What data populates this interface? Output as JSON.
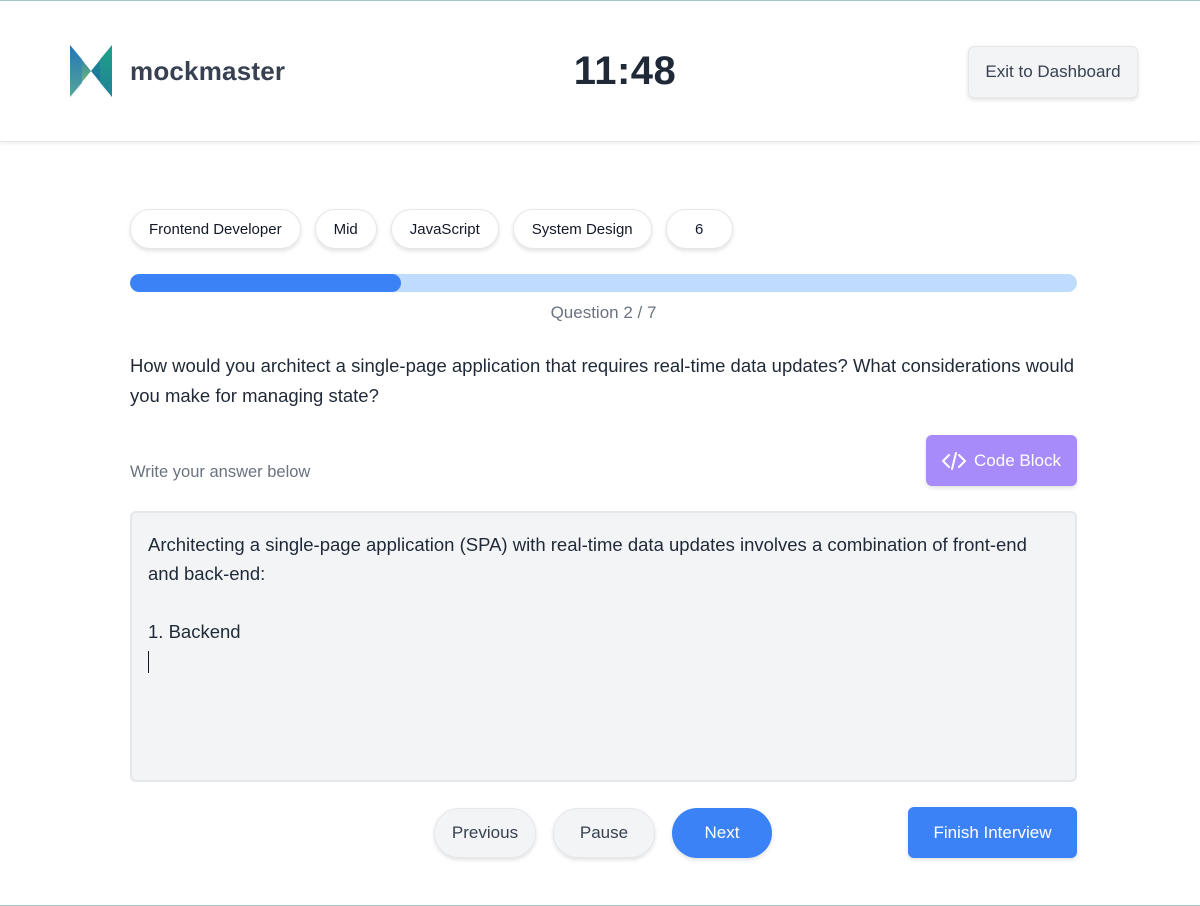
{
  "header": {
    "logo_text": "mockmaster",
    "timer": "11:48",
    "exit_label": "Exit to Dashboard"
  },
  "tags": [
    "Frontend Developer",
    "Mid",
    "JavaScript",
    "System Design",
    "6"
  ],
  "progress": {
    "current": 2,
    "total": 7,
    "fraction": 0.2857,
    "label": "Question 2 / 7"
  },
  "question": "How would you architect a single-page application that requires real-time data updates? What considerations would you make for managing state?",
  "answer": {
    "label": "Write your answer below",
    "code_block_label": "Code Block",
    "text": "Architecting a single-page application (SPA) with real-time data updates involves a combination of front-end and back-end:\n\n1. Backend\n"
  },
  "controls": {
    "previous_label": "Previous",
    "pause_label": "Pause",
    "next_label": "Next",
    "finish_label": "Finish Interview"
  },
  "colors": {
    "primary": "#3b82f6",
    "progress_track": "#bfdbfe",
    "code_button": "#a78bfa"
  }
}
